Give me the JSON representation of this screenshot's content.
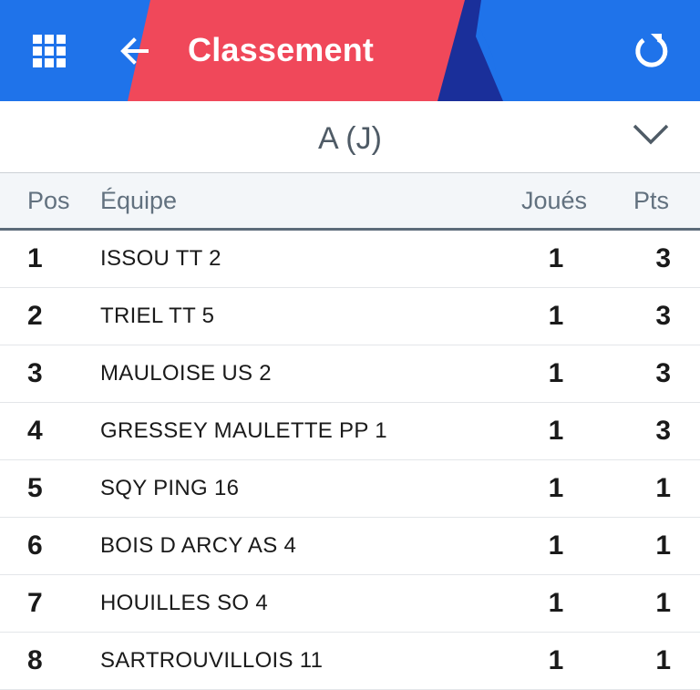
{
  "header": {
    "title": "Classement",
    "grid_icon": "grid-icon",
    "back_icon": "arrow-left-icon",
    "refresh_icon": "refresh-icon",
    "colors": {
      "blue": "#1f73ea",
      "red": "#f0485a",
      "navy": "#1a2f9a"
    }
  },
  "group_selector": {
    "label": "A (J)",
    "icon": "chevron-down-icon"
  },
  "table": {
    "columns": {
      "pos": "Pos",
      "team": "Équipe",
      "played": "Joués",
      "points": "Pts"
    },
    "rows": [
      {
        "pos": "1",
        "team": "ISSOU TT 2",
        "played": "1",
        "points": "3"
      },
      {
        "pos": "2",
        "team": "TRIEL TT 5",
        "played": "1",
        "points": "3"
      },
      {
        "pos": "3",
        "team": "MAULOISE US 2",
        "played": "1",
        "points": "3"
      },
      {
        "pos": "4",
        "team": "GRESSEY MAULETTE PP 1",
        "played": "1",
        "points": "3"
      },
      {
        "pos": "5",
        "team": "SQY PING 16",
        "played": "1",
        "points": "1"
      },
      {
        "pos": "6",
        "team": "BOIS D ARCY AS 4",
        "played": "1",
        "points": "1"
      },
      {
        "pos": "7",
        "team": "HOUILLES SO 4",
        "played": "1",
        "points": "1"
      },
      {
        "pos": "8",
        "team": "SARTROUVILLOIS 11",
        "played": "1",
        "points": "1"
      }
    ]
  }
}
